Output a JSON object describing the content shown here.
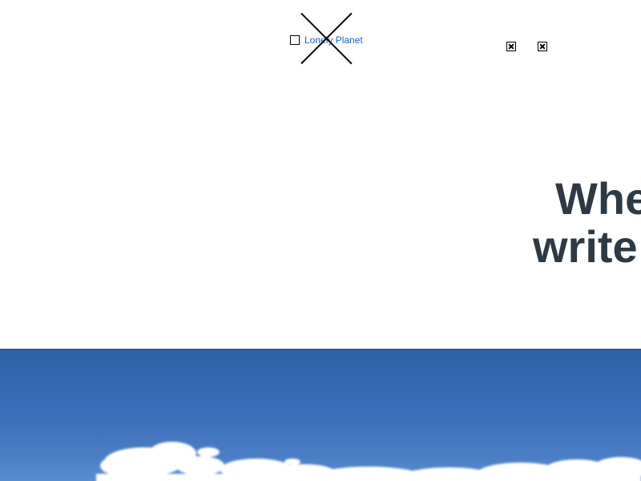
{
  "header": {
    "logo_link_text": "Lonely Planet",
    "nav_icons": [
      "broken-image-icon",
      "broken-image-icon"
    ]
  },
  "hero": {
    "headline_line1": "Whe",
    "headline_line2": "write",
    "sky_color": "#3a6db7",
    "cloud_color": "#ffffff",
    "headline_color": "#2d3a44",
    "link_color": "#1a62c8"
  }
}
